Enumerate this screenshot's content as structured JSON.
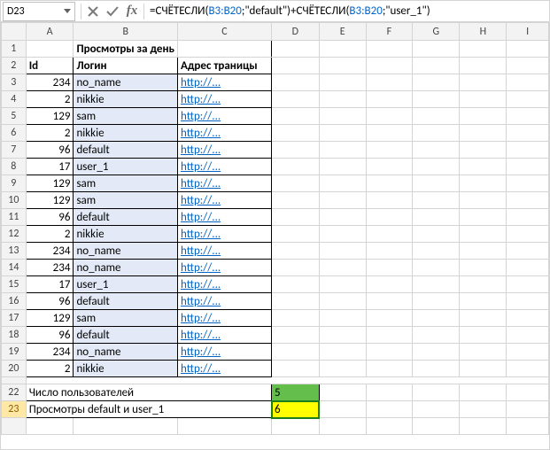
{
  "formula_bar": {
    "name_box": "D23",
    "formula_prefix": "=СЧЁТЕСЛИ(",
    "range1": "B3:B20",
    "mid1": ";\"default\")+СЧЁТЕСЛИ(",
    "range2": "B3:B20",
    "suffix": ";\"user_1\")"
  },
  "columns": [
    "A",
    "B",
    "C",
    "D",
    "E",
    "F",
    "G",
    "H",
    "I"
  ],
  "row_headers": [
    "1",
    "2",
    "3",
    "4",
    "5",
    "6",
    "7",
    "8",
    "9",
    "10",
    "11",
    "12",
    "13",
    "14",
    "15",
    "16",
    "17",
    "18",
    "19",
    "20",
    "22",
    "23"
  ],
  "title_row": "Просмотры за день",
  "headers": {
    "id": "Id",
    "login": "Логин",
    "addr": "Адрес траницы"
  },
  "rows": [
    {
      "id": "234",
      "login": "no_name",
      "url": "http://..."
    },
    {
      "id": "2",
      "login": "nikkie",
      "url": "http://..."
    },
    {
      "id": "129",
      "login": "sam",
      "url": "http://..."
    },
    {
      "id": "2",
      "login": "nikkie",
      "url": "http://..."
    },
    {
      "id": "96",
      "login": "default",
      "url": "http://..."
    },
    {
      "id": "17",
      "login": "user_1",
      "url": "http://..."
    },
    {
      "id": "129",
      "login": "sam",
      "url": "http://..."
    },
    {
      "id": "129",
      "login": "sam",
      "url": "http://..."
    },
    {
      "id": "96",
      "login": "default",
      "url": "http://..."
    },
    {
      "id": "2",
      "login": "nikkie",
      "url": "http://..."
    },
    {
      "id": "234",
      "login": "no_name",
      "url": "http://..."
    },
    {
      "id": "234",
      "login": "no_name",
      "url": "http://..."
    },
    {
      "id": "17",
      "login": "user_1",
      "url": "http://..."
    },
    {
      "id": "96",
      "login": "default",
      "url": "http://..."
    },
    {
      "id": "129",
      "login": "sam",
      "url": "http://..."
    },
    {
      "id": "96",
      "login": "default",
      "url": "http://..."
    },
    {
      "id": "234",
      "login": "no_name",
      "url": "http://..."
    },
    {
      "id": "2",
      "login": "nikkie",
      "url": "http://..."
    }
  ],
  "summary": {
    "users_label": "Число пользователей",
    "users_value": "5",
    "views_label": "Просмотры default и user_1",
    "views_value": "6"
  }
}
